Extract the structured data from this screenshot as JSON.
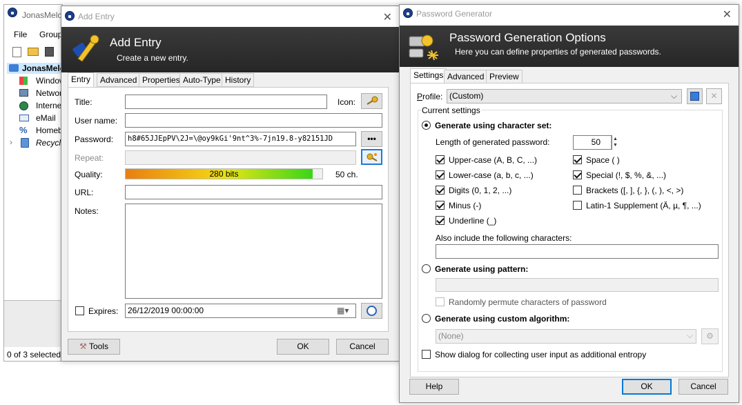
{
  "main_window": {
    "title": "JonasMelc",
    "menu": [
      "File",
      "Group"
    ],
    "tree": [
      {
        "label": "JonasMelo",
        "icon": "folder-icon"
      },
      {
        "label": "Window",
        "icon": "windows-icon"
      },
      {
        "label": "Networ",
        "icon": "network-icon"
      },
      {
        "label": "Interne",
        "icon": "globe-icon"
      },
      {
        "label": "eMail",
        "icon": "email-icon"
      },
      {
        "label": "Homeb",
        "icon": "percent-icon"
      },
      {
        "label": "Recycle",
        "icon": "recycle-bin-icon"
      }
    ],
    "status": "0 of 3 selected"
  },
  "add_entry": {
    "titlebar": "Add Entry",
    "header_title": "Add Entry",
    "header_subtitle": "Create a new entry.",
    "tabs": [
      "Entry",
      "Advanced",
      "Properties",
      "Auto-Type",
      "History"
    ],
    "active_tab": "Entry",
    "labels": {
      "title": "Title:",
      "icon": "Icon:",
      "username": "User name:",
      "password": "Password:",
      "repeat": "Repeat:",
      "quality": "Quality:",
      "url": "URL:",
      "notes": "Notes:",
      "expires": "Expires:"
    },
    "password_value": "h8#65JJEpPV\\2J=\\@oy9kGi'9nt^3%-7jn19.8-y82151JD",
    "dots_label": "•••",
    "quality_text": "280 bits",
    "quality_fraction": 0.95,
    "chars_text": "50 ch.",
    "expires_value": "26/12/2019 00:00:00",
    "expires_checked": false,
    "buttons": {
      "tools": "Tools",
      "ok": "OK",
      "cancel": "Cancel"
    }
  },
  "pwgen": {
    "titlebar": "Password Generator",
    "header_title": "Password Generation Options",
    "header_subtitle": "Here you can define properties of generated passwords.",
    "tabs": [
      "Settings",
      "Advanced",
      "Preview"
    ],
    "active_tab": "Settings",
    "profile_label": "Profile:",
    "profile_value": "(Custom)",
    "current_settings": "Current settings",
    "radio_charset": "Generate using character set:",
    "length_label": "Length of generated password:",
    "length_value": "50",
    "charset_left": [
      {
        "label": "Upper-case (A, B, C, ...)",
        "checked": true
      },
      {
        "label": "Lower-case (a, b, c, ...)",
        "checked": true
      },
      {
        "label": "Digits (0, 1, 2, ...)",
        "checked": true
      },
      {
        "label": "Minus (-)",
        "checked": true
      },
      {
        "label": "Underline (_)",
        "checked": true
      }
    ],
    "charset_right": [
      {
        "label": "Space ( )",
        "checked": true
      },
      {
        "label": "Special (!, $, %, &, ...)",
        "checked": true
      },
      {
        "label": "Brackets ([, ], {, }, (, ), <, >)",
        "checked": false
      },
      {
        "label": "Latin-1 Supplement (Ä, µ, ¶, ...)",
        "checked": false
      }
    ],
    "also_include_label": "Also include the following characters:",
    "also_include_value": "",
    "radio_pattern": "Generate using pattern:",
    "pattern_value": "",
    "permute_label": "Randomly permute characters of password",
    "radio_custom": "Generate using custom algorithm:",
    "custom_value": "(None)",
    "show_dialog_label": "Show dialog for collecting user input as additional entropy",
    "buttons": {
      "help": "Help",
      "ok": "OK",
      "cancel": "Cancel"
    }
  }
}
